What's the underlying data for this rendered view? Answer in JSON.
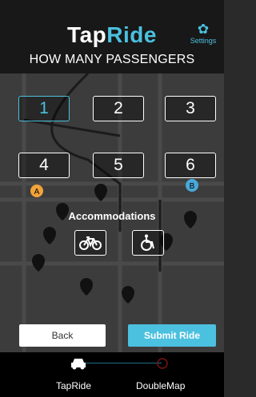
{
  "header": {
    "logo_tap": "Tap",
    "logo_ride": "Ride",
    "settings_label": "Settings",
    "subtitle": "HOW MANY PASSENGERS"
  },
  "passengers": {
    "options": [
      "1",
      "2",
      "3",
      "4",
      "5",
      "6"
    ],
    "selected": "1"
  },
  "accommodations": {
    "title": "Accommodations",
    "icons": [
      "bicycle-icon",
      "wheelchair-icon"
    ]
  },
  "actions": {
    "back_label": "Back",
    "submit_label": "Submit Ride"
  },
  "bottom_nav": {
    "tabs": [
      {
        "label": "TapRide",
        "icon": "car-icon"
      },
      {
        "label": "DoubleMap",
        "icon": "circle-icon"
      }
    ]
  },
  "map": {
    "markers": [
      "A",
      "B"
    ]
  },
  "colors": {
    "accent": "#4bc0df",
    "header_bg": "#141414",
    "bottom_bg": "#000000",
    "map_pin": "#111111",
    "map_road": "#555555",
    "marker_a": "#f2a33a",
    "marker_b": "#4aa8d8",
    "map_block": "#cccccc"
  }
}
